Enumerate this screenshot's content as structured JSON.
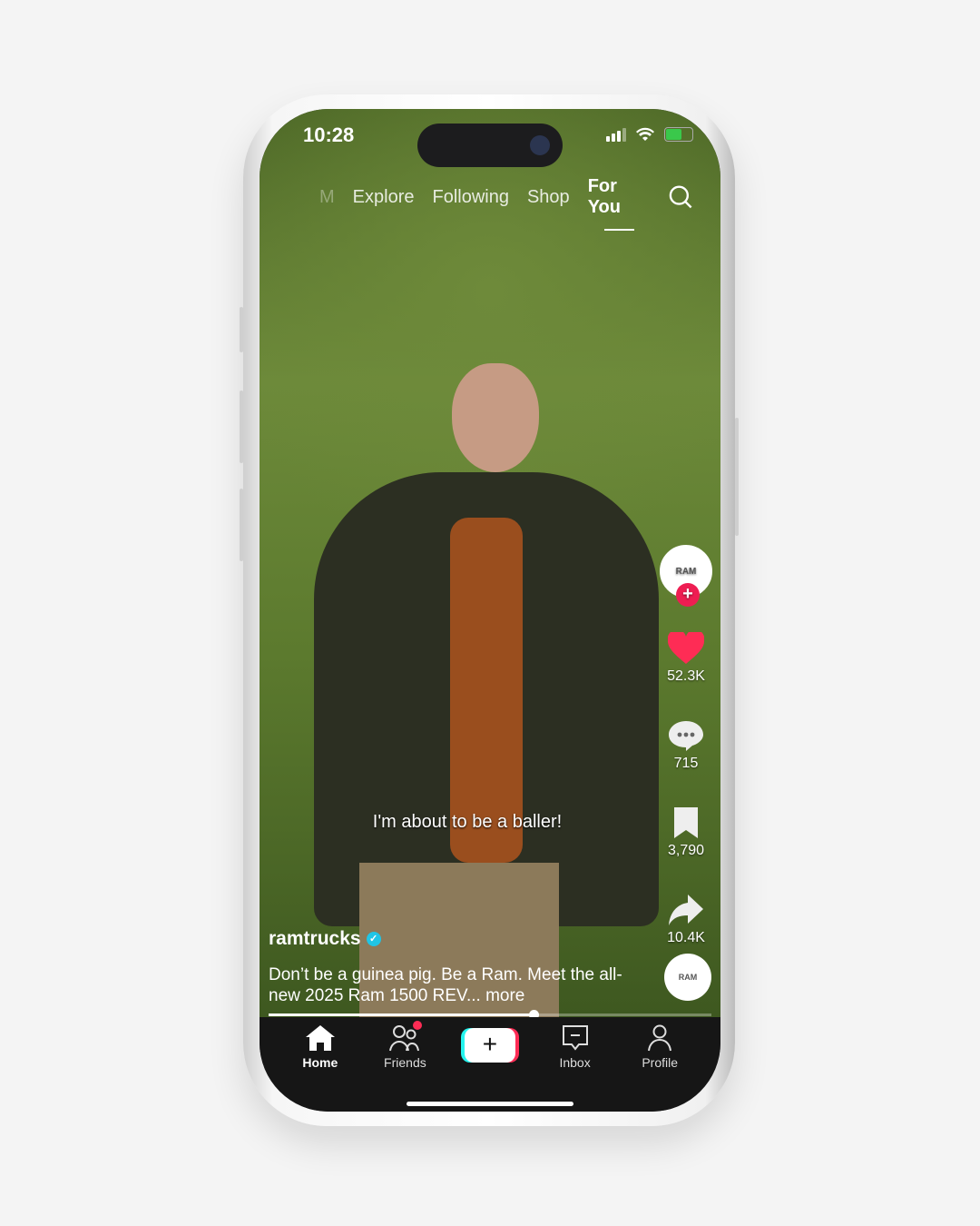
{
  "status": {
    "time": "10:28"
  },
  "nav": {
    "tabs": [
      "M",
      "Explore",
      "Following",
      "Shop",
      "For You"
    ],
    "active": "For You"
  },
  "caption": "I'm about to be a baller!",
  "rail": {
    "avatar_text": "RAM",
    "likes": "52.3K",
    "comments": "715",
    "saves": "3,790",
    "shares": "10.4K"
  },
  "post": {
    "username": "ramtrucks",
    "description": "Don’t be a guinea pig. Be a Ram. Meet the all-new 2025 Ram 1500 REV...",
    "more": "more",
    "progress_percent": 60
  },
  "tabbar": {
    "home": "Home",
    "friends": "Friends",
    "inbox": "Inbox",
    "profile": "Profile",
    "create": "+"
  },
  "colors": {
    "accent": "#fe2c55",
    "verified": "#20c5e6",
    "cyan": "#25f4ee"
  }
}
